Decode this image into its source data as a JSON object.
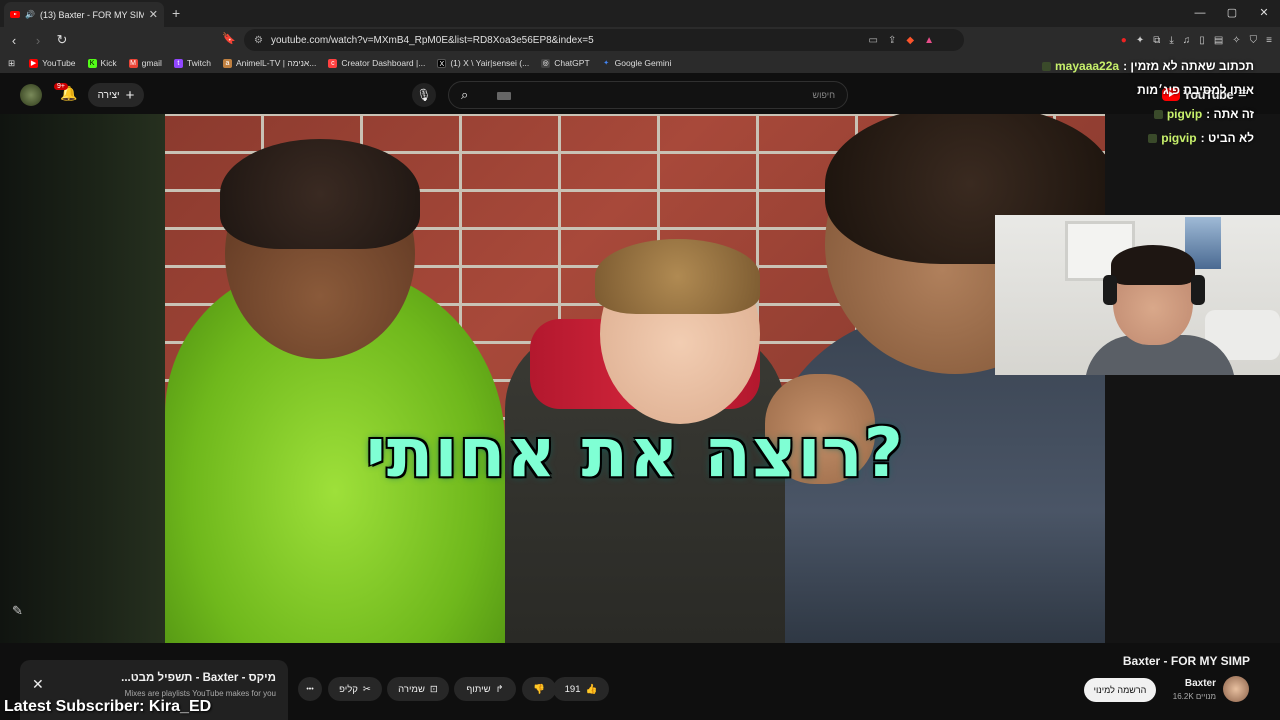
{
  "browser": {
    "tab_title": "(13) Baxter - FOR MY SIMP",
    "new_tab": "+",
    "url_site_icon": "⚙",
    "url": "youtube.com/watch?v=MXmB4_RpM0E&list=RD8Xoa3e56EP8&index=5",
    "window_controls": [
      "—",
      "▢",
      "✕"
    ]
  },
  "bookmarks": [
    {
      "label": "YouTube",
      "icon": "yt-icon",
      "color": "#ff0000"
    },
    {
      "label": "Kick",
      "icon": "kick-icon",
      "color": "#53fc18"
    },
    {
      "label": "gmail",
      "icon": "gmail-icon",
      "color": "#ea4335"
    },
    {
      "label": "Twitch",
      "icon": "twitch-icon",
      "color": "#9146ff"
    },
    {
      "label": "AnimelL-TV | אנימה...",
      "icon": "anime-icon",
      "color": "#c08040"
    },
    {
      "label": "Creator Dashboard |...",
      "icon": "creator-icon",
      "color": "#ff4040"
    },
    {
      "label": "(1) X \\ Yair|sensei (...",
      "icon": "x-icon",
      "color": "#000000"
    },
    {
      "label": "ChatGPT",
      "icon": "chatgpt-icon",
      "color": "#cccccc"
    },
    {
      "label": "Google Gemini",
      "icon": "gemini-icon",
      "color": "#4285f4"
    }
  ],
  "youtube": {
    "notification_count": "9+",
    "create_label": "יצירה",
    "search_placeholder": "חיפוש",
    "logo_text": "YouTube"
  },
  "video": {
    "caption": "רוצה את אחותי?"
  },
  "chat": [
    {
      "user": "mayaaa22a",
      "message": "תכתוב שאתה לא מזמין :"
    },
    {
      "user": "",
      "message": "אותו למסיבת פיג׳מות"
    },
    {
      "user": "pigvip",
      "message": "זה אתה :"
    },
    {
      "user": "pigvip",
      "message": "לא הביט :"
    }
  ],
  "below_video": {
    "title": "Baxter - FOR MY SIMP",
    "channel": "Baxter",
    "subscribers": "16.2K מנויים",
    "subscribe_label": "הרשמה למינוי",
    "like_count": "191",
    "share_label": "שיתוף",
    "save_label": "שמירה",
    "clip_label": "קליפ",
    "more_label": "•••"
  },
  "mix_panel": {
    "title": "מיקס - Baxter - תשפיל מבט...",
    "subtitle": "Mixes are playlists YouTube makes for you"
  },
  "overlay": {
    "latest_subscriber": "Latest Subscriber: Kira_ED"
  },
  "colors": {
    "caption": "#7fffd4",
    "chat_user": "#c7f06b",
    "youtube_red": "#ff0000"
  }
}
